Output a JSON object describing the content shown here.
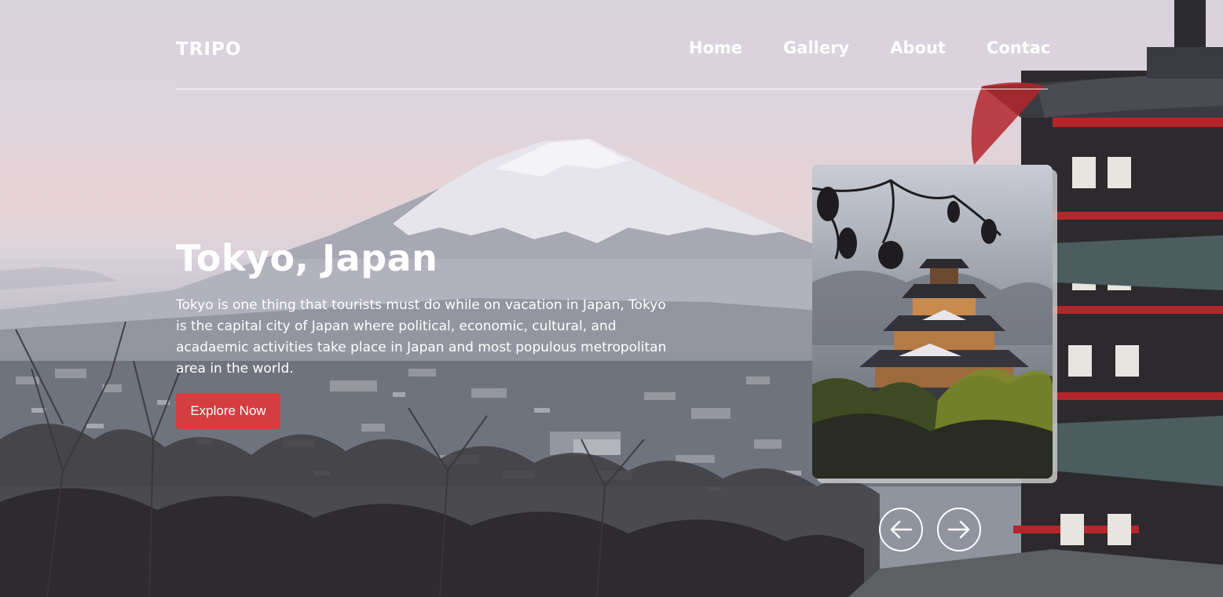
{
  "brand": {
    "logo": "TRIPO"
  },
  "nav": {
    "items": [
      {
        "label": "Home"
      },
      {
        "label": "Gallery"
      },
      {
        "label": "About"
      },
      {
        "label": "Contac"
      }
    ]
  },
  "hero": {
    "title": "Tokyo, Japan",
    "description": "Tokyo is one thing that tourists must do while on vacation in Japan, Tokyo is the capital city of Japan where political, economic, cultural, and acadaemic activities take place in Japan and most populous metropolitan area in the world.",
    "cta_label": "Explore Now"
  },
  "slider": {
    "prev_icon": "arrow-left-icon",
    "next_icon": "arrow-right-icon"
  },
  "colors": {
    "accent": "#d63d3f",
    "text": "#ffffff",
    "sky_top": "#d8d2dc",
    "sky_pink": "#e7d3d6"
  }
}
